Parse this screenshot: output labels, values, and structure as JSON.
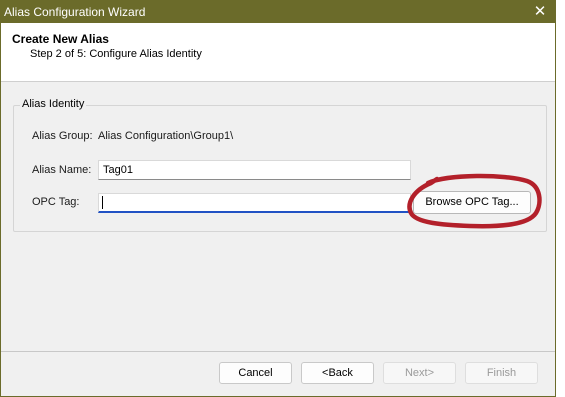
{
  "window": {
    "title": "Alias Configuration Wizard",
    "close_glyph": "✕",
    "accent_color": "#6b6b2a"
  },
  "header": {
    "title": "Create New Alias",
    "subtitle": "Step 2 of 5: Configure Alias Identity"
  },
  "group": {
    "legend": "Alias Identity",
    "alias_group_label": "Alias Group:",
    "alias_group_value": "Alias Configuration\\Group1\\",
    "alias_name_label": "Alias Name:",
    "alias_name_value": "Tag01",
    "opc_tag_label": "OPC Tag:",
    "opc_tag_value": "",
    "browse_label": "Browse OPC Tag..."
  },
  "footer": {
    "cancel_label": "Cancel",
    "back_label": "<Back",
    "next_label": "Next>",
    "finish_label": "Finish"
  },
  "annotation": {
    "color": "#b3202a",
    "icon": "hand-drawn-circle"
  }
}
